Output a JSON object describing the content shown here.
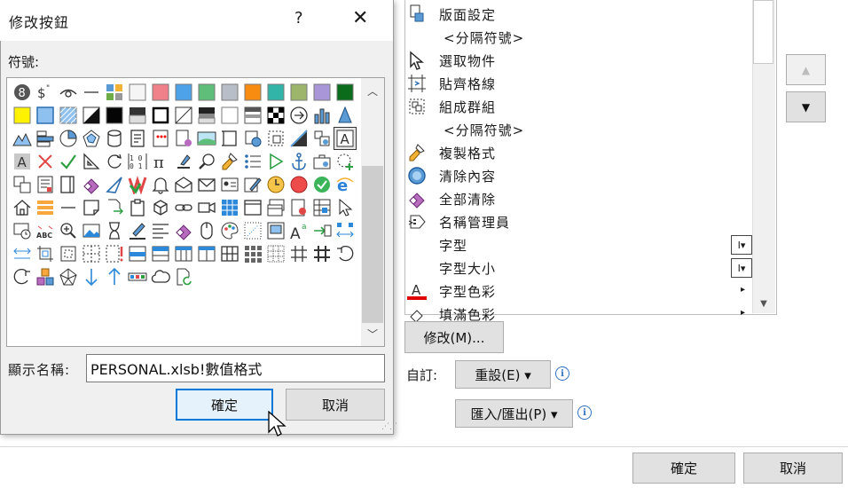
{
  "dialog": {
    "title": "修改按鈕",
    "help_glyph": "?",
    "close_glyph": "✕",
    "symbols_label": "符號:",
    "display_name_label": "顯示名稱:",
    "display_name_value": "PERSONAL.xlsb!數值格式",
    "ok_label": "確定",
    "cancel_label": "取消"
  },
  "command_list": [
    {
      "label": "版面設定",
      "icon": "page-setup-icon",
      "kind": "cmd"
    },
    {
      "label": "<分隔符號>",
      "icon": "",
      "kind": "sep"
    },
    {
      "label": "選取物件",
      "icon": "select-pointer-icon",
      "kind": "cmd"
    },
    {
      "label": "貼齊格線",
      "icon": "snap-grid-icon",
      "kind": "cmd"
    },
    {
      "label": "組成群組",
      "icon": "group-icon",
      "kind": "cmd"
    },
    {
      "label": "<分隔符號>",
      "icon": "",
      "kind": "sep"
    },
    {
      "label": "複製格式",
      "icon": "format-painter-icon",
      "kind": "cmd"
    },
    {
      "label": "清除內容",
      "icon": "clear-contents-icon",
      "kind": "cmd"
    },
    {
      "label": "全部清除",
      "icon": "eraser-icon",
      "kind": "cmd"
    },
    {
      "label": "名稱管理員",
      "icon": "name-manager-icon",
      "kind": "cmd"
    },
    {
      "label": "字型",
      "icon": "",
      "kind": "cmd",
      "tail": "I▾"
    },
    {
      "label": "字型大小",
      "icon": "",
      "kind": "cmd",
      "tail": "I▾"
    },
    {
      "label": "字型色彩",
      "icon": "font-color-icon",
      "kind": "cmd",
      "tail_arrow": "▸"
    },
    {
      "label": "填滿色彩",
      "icon": "fill-color-icon",
      "kind": "cmd",
      "tail_arrow": "▸"
    }
  ],
  "options": {
    "move_up_glyph": "▲",
    "move_down_glyph": "▼",
    "modify_label": "修改(M)...",
    "custom_label": "自訂:",
    "reset_label": "重設(E) ▾",
    "import_export_label": "匯入/匯出(P) ▾",
    "info_glyph": "i",
    "ok_label": "確定",
    "cancel_label": "取消"
  },
  "icons": [
    "circle-8-icon",
    "dollar-icon",
    "eye-icon",
    "dash-icon",
    "tiles-icon",
    "white-square-icon",
    "pink-square-icon",
    "blue-square-icon",
    "green-square-icon",
    "gray-square-icon",
    "orange-square-icon",
    "teal-square-icon",
    "olive-square-icon",
    "lavender-square-icon",
    "darkgreen-square-icon",
    "yellow-square-icon",
    "lightblue-square-icon",
    "hatched-blue-square-icon",
    "half-black-square-icon",
    "black-square-icon",
    "gradient-square-icon",
    "bold-border-square-icon",
    "diagonal-square-icon",
    "dark-gradient-square-icon",
    "white-square-2-icon",
    "striped-square-icon",
    "checker-icon",
    "arrow-circle-icon",
    "bar-chart-icon",
    "cone-icon",
    "mountain-icon",
    "bar-horizontal-icon",
    "pie-chart-icon",
    "radar-icon",
    "cylinder-icon",
    "form-icon",
    "dots-form-icon",
    "database-form-icon",
    "landscape-icon",
    "frame-icon",
    "web-frame-icon",
    "dashed-frame-icon",
    "diagonal-fill-icon",
    "shapes-icon",
    "text-a-box-icon",
    "text-a-gray-icon",
    "red-x-icon",
    "green-check-icon",
    "ruler-triangle-icon",
    "refresh-icon",
    "binary-icon",
    "pi-icon",
    "pen-down-icon",
    "magnifier-icon",
    "paintbrush-icon",
    "bullet-list-icon",
    "play-outline-icon",
    "anchor-icon",
    "briefcase-icon",
    "dashed-circle-plus-icon",
    "copy-frames-icon",
    "receipt-icon",
    "book-icon",
    "purple-eraser-icon",
    "pen-nib-icon",
    "colorful-chart-icon",
    "bell-icon",
    "envelope-open-icon",
    "envelope-icon",
    "contact-card-icon",
    "edit-form-icon",
    "clock-icon",
    "red-circle-icon",
    "green-check-circle-icon",
    "ie-icon",
    "home-icon",
    "stack-icon",
    "dash-2-icon",
    "note-icon",
    "doc-arrows-icon",
    "clipboard-icon",
    "cube-icon",
    "link-icon",
    "video-icon",
    "blue-grid-icon",
    "window-icon",
    "window-stack-icon",
    "certificate-icon",
    "sheet-grid-icon",
    "pointer-icon",
    "clock-board-icon",
    "abc-icon",
    "zoom-in-icon",
    "picture-icon",
    "hourglass-icon",
    "pen-line-icon",
    "align-left-icon",
    "eraser-2-icon",
    "mouse-icon",
    "palette-icon",
    "dotted-frame-icon",
    "frame-window-icon",
    "superscript-a-icon",
    "goal-seek-icon",
    "distribute-icon",
    "spread-arrows-icon",
    "crop-icon",
    "resize-icon",
    "dashed-grid-icon",
    "exclamation-frame-icon",
    "table-2-icon",
    "table-header-icon",
    "table-cols-icon",
    "table-split-icon",
    "grid-4-icon",
    "grid-9-icon",
    "dotted-grid-icon",
    "hash-icon",
    "hash-bold-icon",
    "undo-icon",
    "redo-icon",
    "boxes-icon",
    "spider-icon",
    "arrow-down-icon",
    "arrow-up-icon",
    "ribbon-icon",
    "cloud-icon",
    "doc-refresh-icon"
  ]
}
